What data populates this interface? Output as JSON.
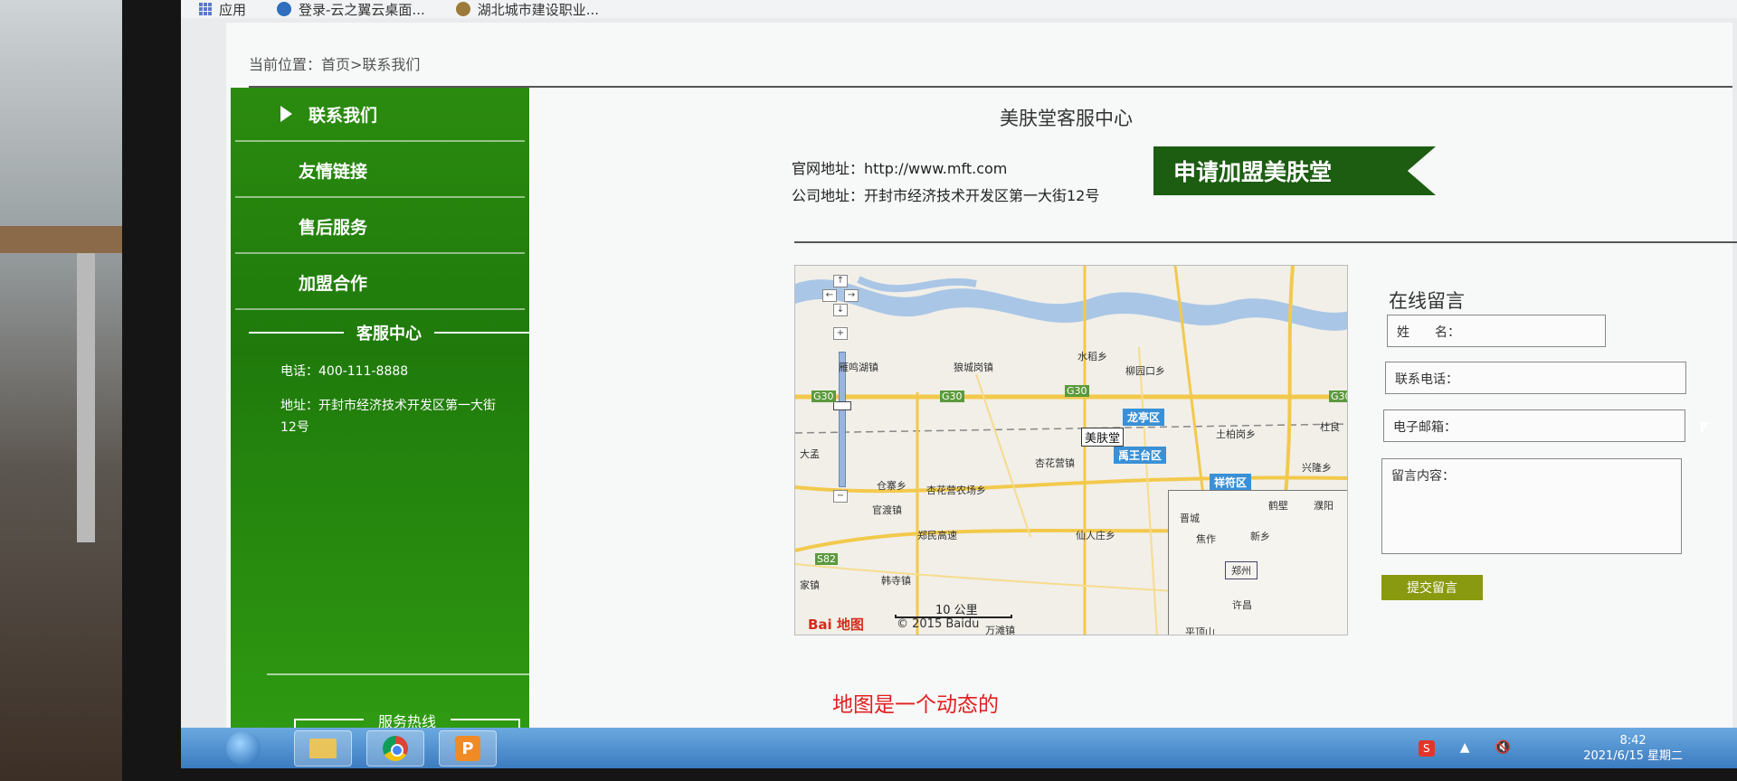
{
  "bookmarks": [
    {
      "label": "应用",
      "icon": "apps-grid-icon"
    },
    {
      "label": "登录-云之翼云桌面...",
      "icon": "cloud-desktop-icon"
    },
    {
      "label": "湖北城市建设职业...",
      "icon": "school-icon"
    }
  ],
  "breadcrumb": "当前位置：首页>联系我们",
  "sidebar": {
    "items": [
      {
        "label": "联系我们",
        "active": true
      },
      {
        "label": "友情链接"
      },
      {
        "label": "售后服务"
      },
      {
        "label": "加盟合作"
      }
    ],
    "service_heading": "客服中心",
    "phone": "电话：400-111-8888",
    "address": "地址：开封市经济技术开发区第一大街12号",
    "hotline": "服务热线"
  },
  "main": {
    "title": "美肤堂客服中心",
    "website": "官网地址：http://www.mft.com",
    "company_address": "公司地址：开封市经济技术开发区第一大街12号",
    "join_banner": "申请加盟美肤堂"
  },
  "map": {
    "marker": "美肤堂",
    "districts": [
      "龙亭区",
      "禹王台区",
      "祥符区"
    ],
    "places": [
      "雁鸣湖镇",
      "狼城岗镇",
      "水稻乡",
      "柳园口乡",
      "土柏岗乡",
      "杏花营镇",
      "仓寨乡",
      "杏花营农场乡",
      "官渡镇",
      "郑民高速",
      "仙人庄乡",
      "韩寺镇",
      "兴隆乡",
      "大孟",
      "万滩镇",
      "家镇",
      "杜良"
    ],
    "highway_labels": [
      "G30",
      "G30",
      "G30",
      "G30",
      "S82"
    ],
    "minimap_places": [
      "鹤壁",
      "濮阳",
      "晋城",
      "焦作",
      "新乡",
      "郑州",
      "许昌",
      "平顶山"
    ],
    "scale": "10 公里",
    "copyright": "© 2015 Baidu",
    "logo": "Bai  地图"
  },
  "form": {
    "title": "在线留言",
    "name_label": "姓　　名：",
    "phone_label": "联系电话：",
    "email_label": "电子邮箱：",
    "message_label": "留言内容：",
    "submit": "提交留言"
  },
  "annotation": "地图是一个动态的",
  "taskbar": {
    "time": "8:42",
    "date": "2021/6/15 星期二",
    "ime": "S"
  }
}
